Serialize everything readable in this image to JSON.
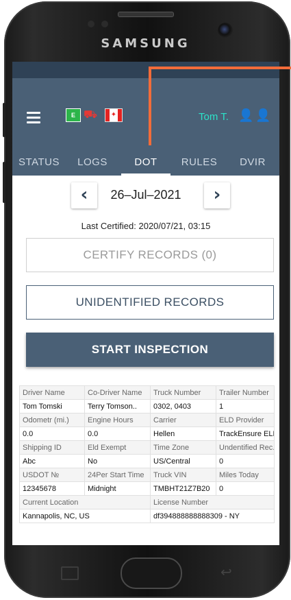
{
  "device": {
    "brand": "SAMSUNG"
  },
  "header": {
    "menu_icon": "hamburger-icon",
    "flags": {
      "eld_label": "E",
      "truck_icon": "truck-icon",
      "canada_icon": "canada-flag-icon"
    },
    "user_name": "Tom T.",
    "user_icons": [
      "driver-icon",
      "co-driver-icon"
    ]
  },
  "tabs": [
    {
      "label": "STATUS",
      "active": false
    },
    {
      "label": "LOGS",
      "active": false
    },
    {
      "label": "DOT",
      "active": true
    },
    {
      "label": "RULES",
      "active": false
    },
    {
      "label": "DVIR",
      "active": false
    }
  ],
  "date_nav": {
    "prev_icon": "‹",
    "date": "26–Jul–2021",
    "next_icon": "›"
  },
  "last_certified": "Last Certified: 2020/07/21, 03:15",
  "buttons": {
    "certify": "CERTIFY RECORDS (0)",
    "unidentified": "UNIDENTIFIED RECORDS",
    "start_inspection": "START INSPECTION"
  },
  "info_table": {
    "r1_labels": [
      "Driver Name",
      "Co-Driver Name",
      "Truck Number",
      "Trailer Number"
    ],
    "r1_values": [
      "Tom Tomski",
      "Terry Tomson..",
      "0302, 0403",
      "1"
    ],
    "r2_labels": [
      "Odometr (mi.)",
      "Engine Hours",
      "Carrier",
      "ELD Provider"
    ],
    "r2_values": [
      "0.0",
      "0.0",
      "Hellen",
      "TrackEnsure ELD"
    ],
    "r3_labels": [
      "Shipping ID",
      "Eld Exempt",
      "Time Zone",
      "Undentified Rec."
    ],
    "r3_values": [
      "Abc",
      "No",
      "US/Central",
      "0"
    ],
    "r4_labels": [
      "USDOT №",
      "24Per Start Time",
      "Truck VIN",
      "Miles Today"
    ],
    "r4_values": [
      "12345678",
      "Midnight",
      "TMBHT21Z7B20",
      "0"
    ],
    "r5_labels": [
      "Current Location",
      "License Number"
    ],
    "r5_values": [
      "Kannapolis, NC, US",
      "df394888888888309 - NY"
    ]
  },
  "colors": {
    "header_bg": "#4a6076",
    "accent_teal": "#2ce3c9",
    "callout": "#f26c3a"
  }
}
